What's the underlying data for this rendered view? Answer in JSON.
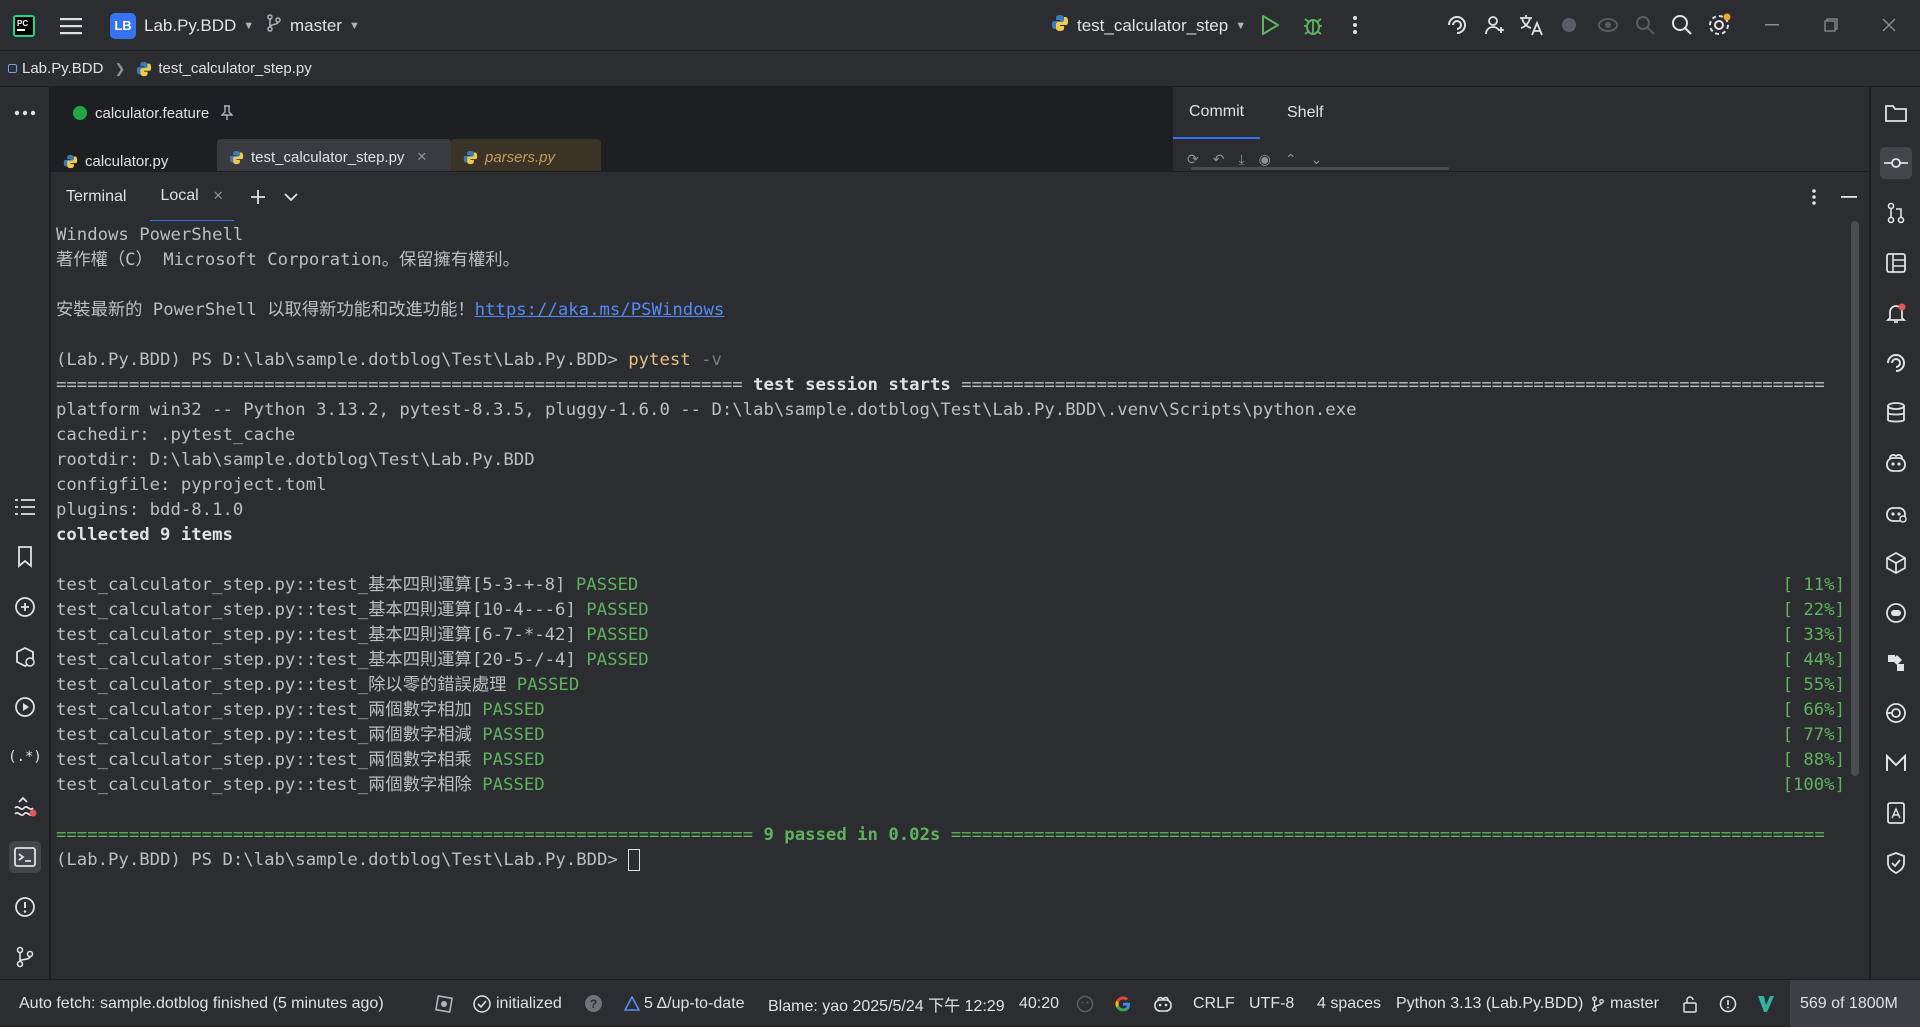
{
  "titlebar": {
    "project_initials": "LB",
    "project_name": "Lab.Py.BDD",
    "branch": "master",
    "run_config": "test_calculator_step"
  },
  "breadcrumb": {
    "project": "Lab.Py.BDD",
    "file": "test_calculator_step.py"
  },
  "editor": {
    "pinned_tab": "calculator.feature",
    "tabs": [
      "calculator.py",
      "test_calculator_step.py",
      "parsers.py"
    ]
  },
  "commit_panel": {
    "tabs": [
      "Commit",
      "Shelf"
    ]
  },
  "terminal": {
    "title": "Terminal",
    "session_tab": "Local",
    "header_lines": [
      "Windows PowerShell",
      "著作權（C） Microsoft Corporation。保留擁有權利。"
    ],
    "install_msg": "安裝最新的 PowerShell 以取得新功能和改進功能！",
    "install_link": "https://aka.ms/PSWindows",
    "prompt": "(Lab.Py.BDD) PS D:\\lab\\sample.dotblog\\Test\\Lab.Py.BDD> ",
    "command": "pytest",
    "command_arg": " -v",
    "session_rule_left": "================================================================== ",
    "session_title": "test session starts",
    "session_rule_right": " ===================================================================================",
    "info_lines": [
      "platform win32 -- Python 3.13.2, pytest-8.3.5, pluggy-1.6.0 -- D:\\lab\\sample.dotblog\\Test\\Lab.Py.BDD\\.venv\\Scripts\\python.exe",
      "cachedir: .pytest_cache",
      "rootdir: D:\\lab\\sample.dotblog\\Test\\Lab.Py.BDD",
      "configfile: pyproject.toml",
      "plugins: bdd-8.1.0"
    ],
    "collected": "collected 9 items",
    "results": [
      {
        "name": "test_calculator_step.py::test_基本四則運算[5-3-+-8]",
        "status": "PASSED",
        "pct": "[ 11%]"
      },
      {
        "name": "test_calculator_step.py::test_基本四則運算[10-4---6]",
        "status": "PASSED",
        "pct": "[ 22%]"
      },
      {
        "name": "test_calculator_step.py::test_基本四則運算[6-7-*-42]",
        "status": "PASSED",
        "pct": "[ 33%]"
      },
      {
        "name": "test_calculator_step.py::test_基本四則運算[20-5-/-4]",
        "status": "PASSED",
        "pct": "[ 44%]"
      },
      {
        "name": "test_calculator_step.py::test_除以零的錯誤處理",
        "status": "PASSED",
        "pct": "[ 55%]"
      },
      {
        "name": "test_calculator_step.py::test_兩個數字相加",
        "status": "PASSED",
        "pct": "[ 66%]"
      },
      {
        "name": "test_calculator_step.py::test_兩個數字相減",
        "status": "PASSED",
        "pct": "[ 77%]"
      },
      {
        "name": "test_calculator_step.py::test_兩個數字相乘",
        "status": "PASSED",
        "pct": "[ 88%]"
      },
      {
        "name": "test_calculator_step.py::test_兩個數字相除",
        "status": "PASSED",
        "pct": "[100%]"
      }
    ],
    "summary_rule_left": "=================================================================== ",
    "summary": "9 passed in 0.02s",
    "summary_rule_right": " ===================================================================================="
  },
  "statusbar": {
    "fetch_msg": "Auto fetch: sample.dotblog finished (5 minutes ago)",
    "initialized": "initialized",
    "vcs_state": "5 Δ/up-to-date",
    "blame": "Blame: yao 2025/5/24 下午 12:29",
    "position": "40:20",
    "line_sep": "CRLF",
    "encoding": "UTF-8",
    "indent": "4 spaces",
    "interpreter": "Python 3.13 (Lab.Py.BDD)",
    "branch": "master",
    "memory": "569 of 1800M"
  },
  "colors": {
    "accent": "#3574f0",
    "passed": "#5fb25e",
    "command": "#e5c07b",
    "link": "#548af7",
    "run": "#5fb25e"
  }
}
